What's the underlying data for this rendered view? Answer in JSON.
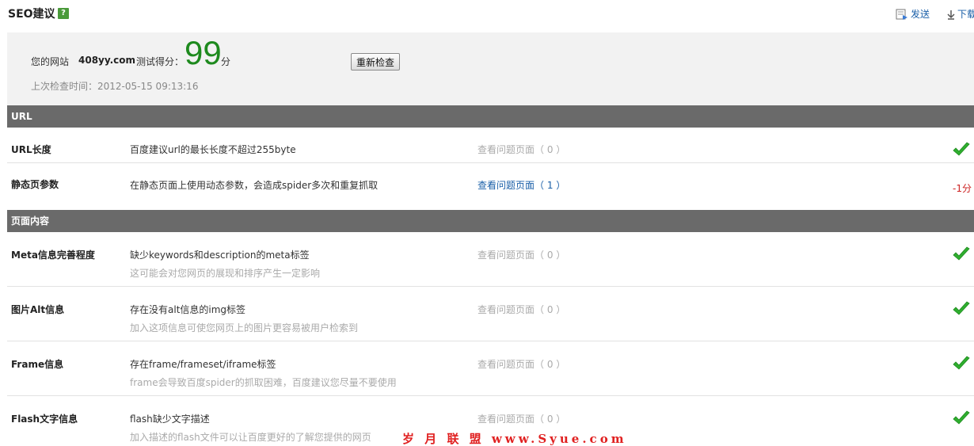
{
  "header": {
    "title": "SEO建议",
    "help_label": "?",
    "send_label": "发送",
    "download_label": "下载"
  },
  "summary": {
    "site_label": "您的网站",
    "site_domain": "408yy.com",
    "score_label": "测试得分：",
    "score_value": "99",
    "score_unit": "分",
    "recheck_label": "重新检查",
    "last_check": "上次检查时间：2012-05-15 09:13:16"
  },
  "sections": {
    "url": {
      "title": "URL",
      "rows": [
        {
          "name": "URL长度",
          "desc": "百度建议url的最长长度不超过255byte",
          "link": "查看问题页面（ 0 ）",
          "status": "pass"
        },
        {
          "name": "静态页参数",
          "desc": "在静态页面上使用动态参数，会造成spider多次和重复抓取",
          "link": "查看问题页面（ 1 ）",
          "status": "fail",
          "penalty": "-1分"
        }
      ]
    },
    "content": {
      "title": "页面内容",
      "rows": [
        {
          "name": "Meta信息完善程度",
          "desc": "缺少keywords和description的meta标签",
          "sub": "这可能会对您网页的展现和排序产生一定影响",
          "link": "查看问题页面（ 0 ）",
          "status": "pass"
        },
        {
          "name": "图片Alt信息",
          "desc": "存在没有alt信息的img标签",
          "sub": "加入这项信息可使您网页上的图片更容易被用户检索到",
          "link": "查看问题页面（ 0 ）",
          "status": "pass"
        },
        {
          "name": "Frame信息",
          "desc": "存在frame/frameset/iframe标签",
          "sub": "frame会导致百度spider的抓取困难，百度建议您尽量不要使用",
          "link": "查看问题页面（ 0 ）",
          "status": "pass"
        },
        {
          "name": "Flash文字信息",
          "desc": "flash缺少文字描述",
          "sub": "加入描述的flash文件可以让百度更好的了解您提供的网页",
          "link": "查看问题页面（ 0 ）",
          "status": "pass"
        }
      ]
    }
  },
  "watermark": "岁 月 联 盟  www.Syue.com",
  "colors": {
    "pass": "#2fae2f",
    "penalty": "#cc2222",
    "link": "#1a5fa8",
    "section_bg": "#6a6a6a",
    "score": "#1e8a1e"
  }
}
